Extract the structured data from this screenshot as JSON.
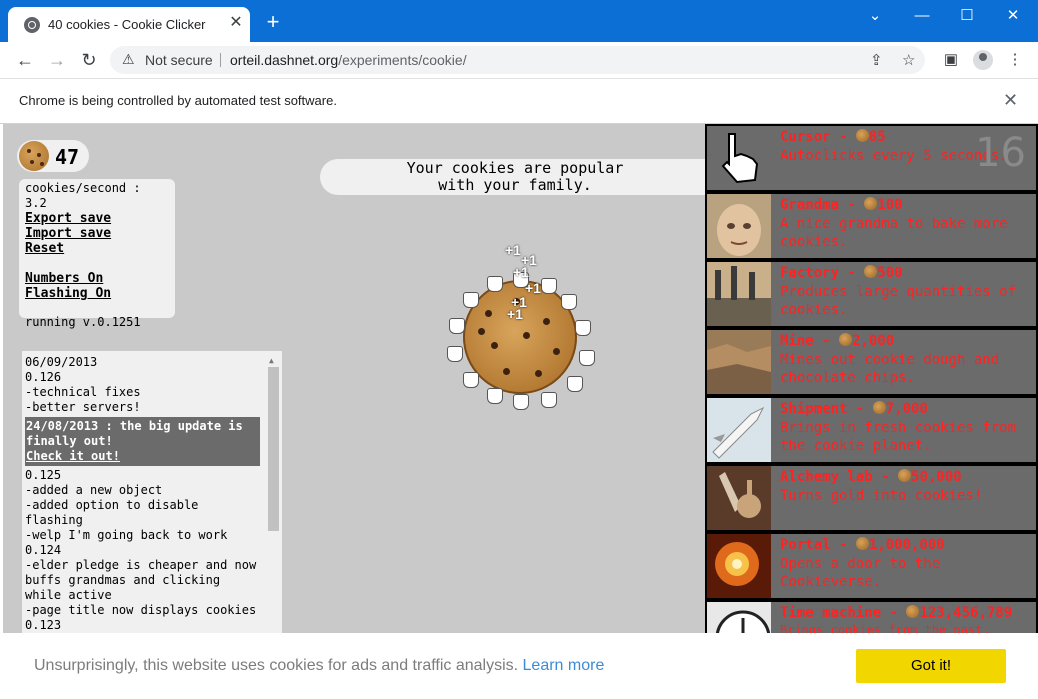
{
  "browser": {
    "tab_title": "40 cookies - Cookie Clicker",
    "security_label": "Not secure",
    "url_host": "orteil.dashnet.org",
    "url_path": "/experiments/cookie/",
    "infobar_text": "Chrome is being controlled by automated test software."
  },
  "game": {
    "cookie_count": "47",
    "stats": {
      "cookies_per_second": "cookies/second : 3.2",
      "export_save": "Export save",
      "import_save": "Import save",
      "reset": "Reset",
      "numbers_on": "Numbers On",
      "flashing_on": "Flashing On",
      "version": "running v.0.1251"
    },
    "news_line1": "Your cookies are popular",
    "news_line2": "with your family.",
    "plus_one": "+1",
    "changelog": {
      "lines_top": [
        "06/09/2013",
        "0.126",
        "-technical fixes",
        "-better servers!"
      ],
      "highlight_title": "24/08/2013 : the big update is finally out!",
      "highlight_link": "Check it out!",
      "lines_bottom": [
        "0.125",
        "-added a new object",
        "-added option to disable flashing",
        "-welp I'm going back to work",
        "0.124",
        "-elder pledge is cheaper and now buffs grandmas and clicking while active",
        "-page title now displays cookies",
        "0.123"
      ]
    },
    "store": [
      {
        "name": "Cursor - ",
        "price": "85",
        "desc": "Autoclicks every 5 seconds.",
        "count": "16",
        "icon": "cursor-icon"
      },
      {
        "name": "Grandma - ",
        "price": "100",
        "desc": "A nice grandma to bake more cookies.",
        "count": "",
        "icon": "grandma-icon"
      },
      {
        "name": "Factory - ",
        "price": "500",
        "desc": "Produces large quantities of cookies.",
        "count": "",
        "icon": "factory-icon"
      },
      {
        "name": "Mine - ",
        "price": "2,000",
        "desc": "Mines out cookie dough and chocolate chips.",
        "count": "",
        "icon": "mine-icon"
      },
      {
        "name": "Shipment - ",
        "price": "7,000",
        "desc": "Brings in fresh cookies from the cookie planet.",
        "count": "",
        "icon": "shipment-icon"
      },
      {
        "name": "Alchemy lab - ",
        "price": "50,000",
        "desc": "Turns gold into cookies!",
        "count": "",
        "icon": "alchemy-lab-icon"
      },
      {
        "name": "Portal - ",
        "price": "1,000,000",
        "desc": "Opens a door to the Cookieverse.",
        "count": "",
        "icon": "portal-icon"
      },
      {
        "name": "Time machine - ",
        "price": "123,456,789",
        "desc": "Brings cookies from the past, before they were even eaten.",
        "count": "",
        "icon": "time-machine-icon"
      }
    ]
  },
  "cookie_banner": {
    "text": "Unsurprisingly, this website uses cookies for ads and traffic analysis.",
    "link": "Learn more",
    "button": "Got it!"
  }
}
